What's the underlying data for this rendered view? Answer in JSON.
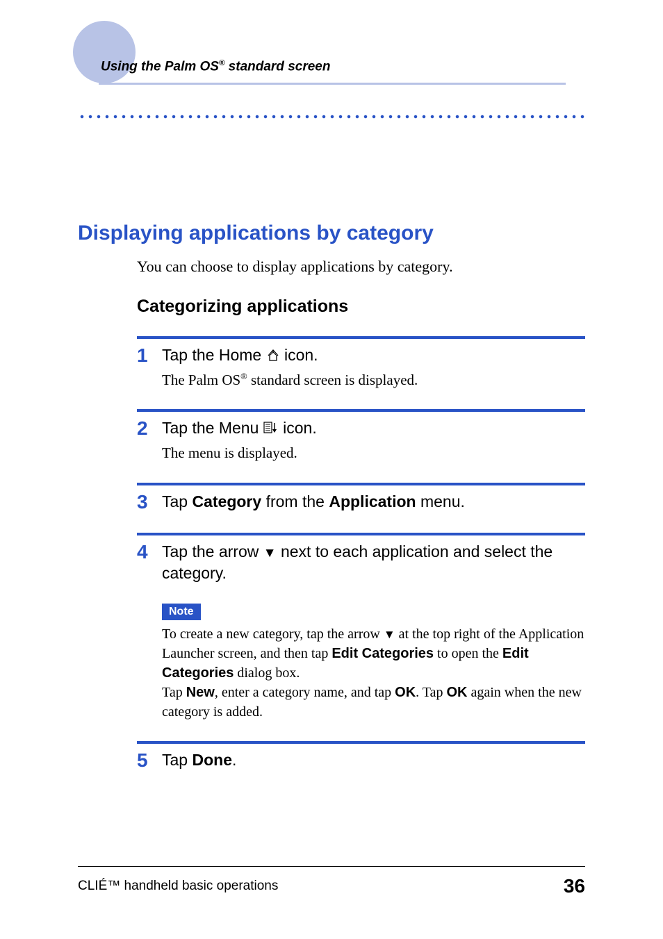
{
  "header": {
    "prefix": "Using the Palm OS",
    "suffix": " standard screen"
  },
  "section_title": "Displaying applications by category",
  "intro": "You can choose to display applications by category.",
  "subheading": "Categorizing applications",
  "steps": {
    "s1": {
      "num": "1",
      "title_a": "Tap the Home ",
      "title_b": " icon.",
      "desc_a": "The Palm OS",
      "desc_b": " standard screen is displayed."
    },
    "s2": {
      "num": "2",
      "title_a": "Tap the Menu ",
      "title_b": " icon.",
      "desc": "The menu is displayed."
    },
    "s3": {
      "num": "3",
      "t1": "Tap ",
      "t2": "Category",
      "t3": " from the ",
      "t4": "Application",
      "t5": " menu."
    },
    "s4": {
      "num": "4",
      "t1": "Tap the arrow ",
      "t2": " next to each application and select the category."
    },
    "note": {
      "label": "Note",
      "n1": "To create a new category, tap the arrow ",
      "n2": " at the top right of the Application Launcher screen, and then tap ",
      "n3": "Edit Categories",
      "n4": " to open the ",
      "n5": "Edit Categories",
      "n6": " dialog box.",
      "n7": "Tap ",
      "n8": "New",
      "n9": ", enter a category name, and tap ",
      "n10": "OK",
      "n11": ". Tap ",
      "n12": "OK",
      "n13": " again when the new category is added."
    },
    "s5": {
      "num": "5",
      "t1": "Tap ",
      "t2": "Done",
      "t3": "."
    }
  },
  "footer": {
    "text": "CLIÉ™ handheld basic operations",
    "page": "36"
  },
  "glyphs": {
    "reg": "®",
    "down_triangle": "▼"
  }
}
